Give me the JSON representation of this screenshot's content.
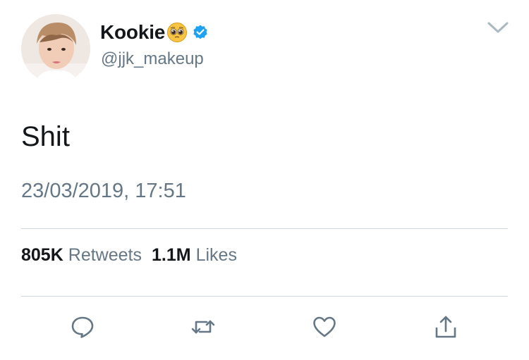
{
  "tweet": {
    "display_name": "Kookie",
    "handle": "@jjk_makeup",
    "text": "Shit",
    "timestamp": "23/03/2019, 17:51",
    "retweets_count": "805K",
    "retweets_label": "Retweets",
    "likes_count": "1.1M",
    "likes_label": "Likes"
  },
  "icons": {
    "name_emoji": "pleading-face-emoji",
    "verified": "verified-badge-icon",
    "menu": "chevron-down-icon",
    "actions": [
      "reply-icon",
      "retweet-icon",
      "like-icon",
      "share-icon"
    ]
  },
  "colors": {
    "verified_blue": "#1da1f2",
    "text_primary": "#14171a",
    "text_secondary": "#657786",
    "divider": "#ccd6dd"
  }
}
